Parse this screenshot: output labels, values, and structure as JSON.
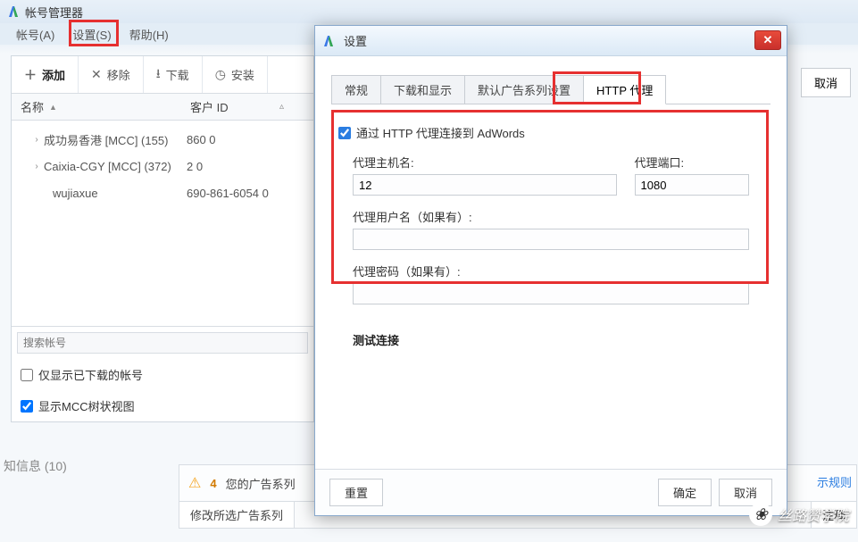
{
  "main": {
    "title": "帐号管理器",
    "menu": {
      "account": "帐号(A)",
      "settings": "设置(S)",
      "help": "帮助(H)"
    },
    "toolbar": {
      "add": "添加",
      "remove": "移除",
      "download": "下载",
      "install": "安装"
    },
    "table": {
      "col_name": "名称",
      "col_id": "客户 ID",
      "rows": [
        {
          "expand": "›",
          "label": "成功易香港 [MCC] (155)",
          "id_prefix": "",
          "id_hidden": "",
          "id_suffix": "860 0"
        },
        {
          "expand": "›",
          "label": "Caixia-CGY [MCC] (372)",
          "id_prefix": "",
          "id_hidden": "",
          "id_suffix": "2 0"
        },
        {
          "expand": "",
          "label": "wujiaxue",
          "id_prefix": "690-861-6054 0",
          "id_hidden": "",
          "id_suffix": ""
        }
      ]
    },
    "search_placeholder": "搜索帐号",
    "check_downloaded": "仅显示已下载的帐号",
    "check_tree": "显示MCC树状视图",
    "footer_info": "知信息 (10)",
    "warn_count": "4",
    "warn_text": "您的广告系列",
    "rule_link": "示规则",
    "bottom_tab": "修改所选广告系列",
    "bottom_tab2": "注释"
  },
  "right": {
    "cancel": "取消"
  },
  "modal": {
    "title": "设置",
    "tabs": {
      "general": "常规",
      "download": "下载和显示",
      "default": "默认广告系列设置",
      "proxy": "HTTP 代理"
    },
    "proxy": {
      "connect_label": "通过 HTTP 代理连接到 AdWords",
      "host_label": "代理主机名:",
      "host_value": "12",
      "port_label": "代理端口:",
      "port_value": "1080",
      "user_label": "代理用户名（如果有）:",
      "user_value": "",
      "pass_label": "代理密码（如果有）:",
      "pass_value": ""
    },
    "test": "测试连接",
    "reset": "重置",
    "ok": "确定",
    "cancel": "取消"
  },
  "watermark": "丝路赞学院"
}
